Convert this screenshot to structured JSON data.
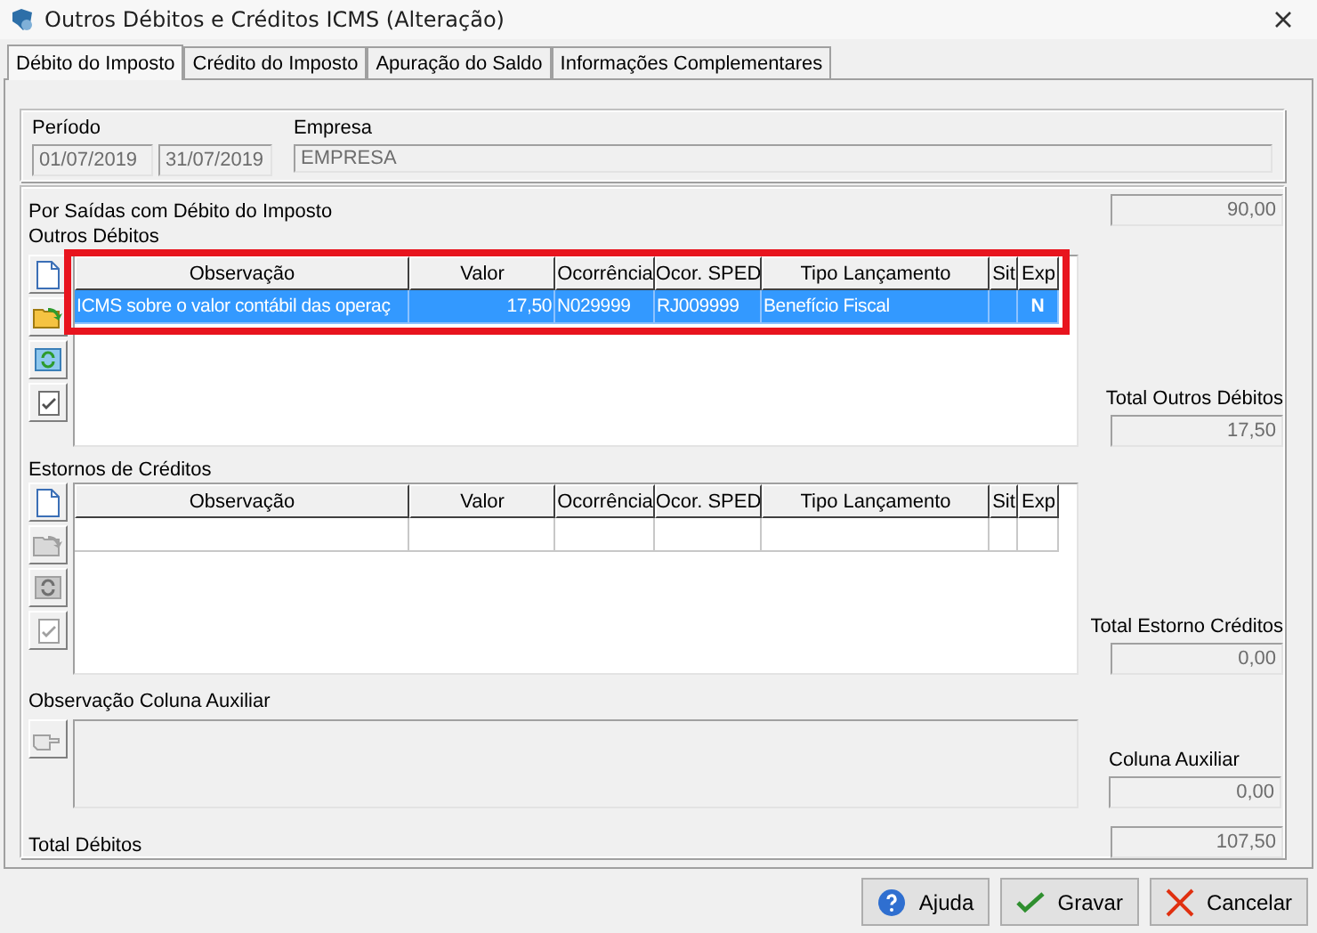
{
  "window": {
    "title": "Outros Débitos e Créditos ICMS (Alteração)"
  },
  "tabs": [
    {
      "label": "Débito do Imposto",
      "selected": true
    },
    {
      "label": "Crédito do Imposto",
      "selected": false
    },
    {
      "label": "Apuração do Saldo",
      "selected": false
    },
    {
      "label": "Informações Complementares",
      "selected": false
    }
  ],
  "header": {
    "period_label": "Período",
    "period_start": "01/07/2019",
    "period_end": "31/07/2019",
    "company_label": "Empresa",
    "company": "EMPRESA"
  },
  "section_title": "Por Saídas com Débito do Imposto",
  "section_value": "90,00",
  "debits": {
    "title": "Outros Débitos",
    "highlighted": true,
    "tools": [
      {
        "kind": "new",
        "disabled": false
      },
      {
        "kind": "open",
        "disabled": false
      },
      {
        "kind": "refresh",
        "disabled": false
      },
      {
        "kind": "check",
        "disabled": false
      }
    ],
    "columns": [
      "Observação",
      "Valor",
      "Ocorrência",
      "Ocor. SPED",
      "Tipo Lançamento",
      "Sit",
      "Exp"
    ],
    "rows": [
      {
        "selected": true,
        "cells": [
          "ICMS sobre o valor contábil das operaç",
          "17,50",
          "N029999",
          "RJ009999",
          "Benefício Fiscal",
          "",
          "N"
        ]
      }
    ],
    "total_label": "Total Outros Débitos",
    "total": "17,50"
  },
  "credits": {
    "title": "Estornos de Créditos",
    "tools": [
      {
        "kind": "new",
        "disabled": false
      },
      {
        "kind": "open",
        "disabled": true
      },
      {
        "kind": "refresh",
        "disabled": true
      },
      {
        "kind": "check",
        "disabled": true
      }
    ],
    "columns": [
      "Observação",
      "Valor",
      "Ocorrência",
      "Ocor. SPED",
      "Tipo Lançamento",
      "Sit",
      "Exp"
    ],
    "total_label": "Total Estorno Créditos",
    "total": "0,00"
  },
  "aux": {
    "title": "Observação Coluna Auxiliar",
    "tool": {
      "kind": "pointer",
      "disabled": true
    },
    "total_label": "Coluna Auxiliar",
    "total": "0,00"
  },
  "total": {
    "label": "Total Débitos",
    "value": "107,50"
  },
  "buttons": [
    {
      "kind": "help",
      "label": "Ajuda"
    },
    {
      "kind": "save",
      "label": "Gravar"
    },
    {
      "kind": "cancel",
      "label": "Cancelar"
    }
  ]
}
